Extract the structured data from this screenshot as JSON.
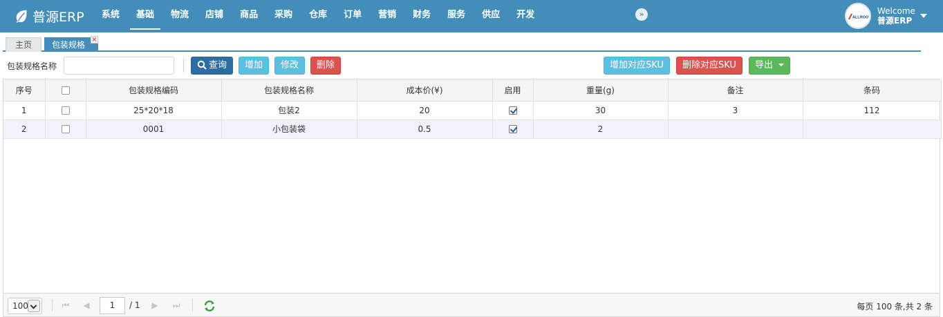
{
  "app": {
    "brand": "普源ERP"
  },
  "nav": {
    "items": [
      {
        "label": "系统"
      },
      {
        "label": "基础"
      },
      {
        "label": "物流"
      },
      {
        "label": "店铺"
      },
      {
        "label": "商品"
      },
      {
        "label": "采购"
      },
      {
        "label": "仓库"
      },
      {
        "label": "订单"
      },
      {
        "label": "营销"
      },
      {
        "label": "财务"
      },
      {
        "label": "服务"
      },
      {
        "label": "供应"
      },
      {
        "label": "开发"
      }
    ],
    "active_index": 1,
    "collapse_glyph": "»"
  },
  "user": {
    "welcome": "Welcome",
    "name": "普源ERP",
    "avatar_text": "ALLROOT"
  },
  "tabs": [
    {
      "label": "主页"
    },
    {
      "label": "包装规格"
    }
  ],
  "toolbar": {
    "search_label": "包装规格名称",
    "search_value": "",
    "query_label": "查询",
    "add_label": "增加",
    "edit_label": "修改",
    "delete_label": "删除",
    "add_sku_label": "增加对应SKU",
    "delete_sku_label": "删除对应SKU",
    "export_label": "导出"
  },
  "table": {
    "columns": [
      "序号",
      "",
      "包装规格编码",
      "包装规格名称",
      "成本价(¥)",
      "启用",
      "重量(g)",
      "备注",
      "条码"
    ],
    "rows": [
      {
        "no": "1",
        "selected": false,
        "code": "25*20*18",
        "name": "包装2",
        "cost": "20",
        "enabled": true,
        "weight": "30",
        "remark": "3",
        "barcode": "112"
      },
      {
        "no": "2",
        "selected": false,
        "code": "0001",
        "name": "小包装袋",
        "cost": "0.5",
        "enabled": true,
        "weight": "2",
        "remark": "",
        "barcode": ""
      }
    ]
  },
  "pager": {
    "page_size": "100",
    "current_page": "1",
    "total_pages": "/ 1",
    "summary": "每页 100 条,共 2 条"
  },
  "colors": {
    "navbar": "#438eb9",
    "primary": "#2e6da4",
    "info": "#5bc0de",
    "danger": "#d9534f",
    "success": "#5cb85c"
  }
}
